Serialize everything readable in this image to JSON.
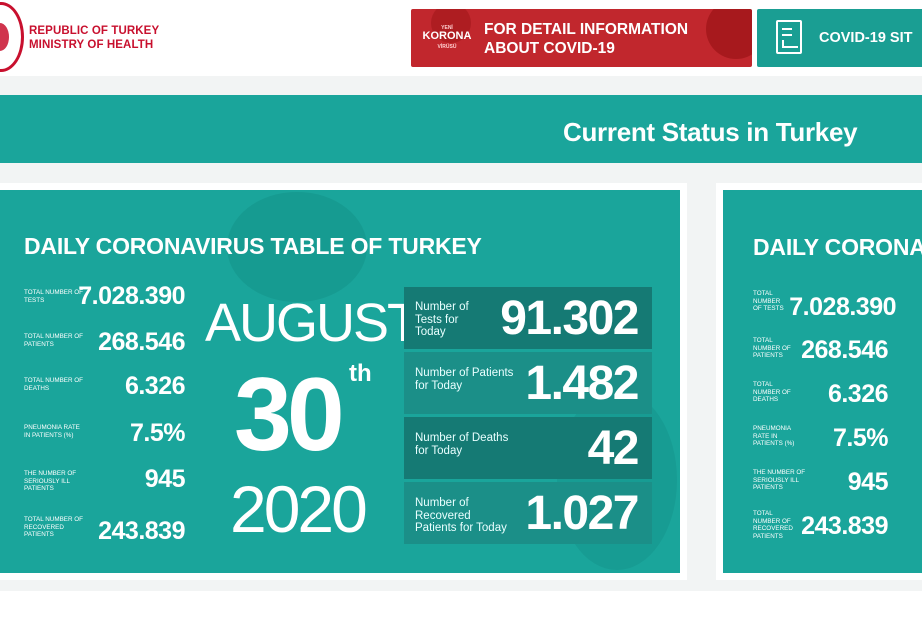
{
  "header": {
    "ministry_line1": "REPUBLIC OF TURKEY",
    "ministry_line2": "MINISTRY OF HEALTH",
    "korona_badge": {
      "top": "YENİ",
      "main": "KORONA",
      "bottom": "VİRÜSÜ"
    },
    "detail_button_line1": "FOR DETAIL INFORMATION",
    "detail_button_line2": "ABOUT COVID-19",
    "site_button_label": "COVID-19 SIT",
    "colors": {
      "brand_red": "#c8102e",
      "teal": "#1aa59b",
      "dark_teal": "#157a74"
    }
  },
  "status_title": "Current Status in Turkey",
  "card1": {
    "title": "DAILY CORONAVIRUS TABLE OF TURKEY",
    "stats": [
      {
        "label": "TOTAL NUMBER OF TESTS",
        "value": "7.028.390"
      },
      {
        "label": "TOTAL NUMBER OF PATIENTS",
        "value": "268.546"
      },
      {
        "label": "TOTAL NUMBER OF DEATHS",
        "value": "6.326"
      },
      {
        "label": "PNEUMONIA RATE IN PATIENTS (%)",
        "value": "7.5%"
      },
      {
        "label": "THE NUMBER OF SERIOUSLY ILL PATIENTS",
        "value": "945"
      },
      {
        "label": "TOTAL NUMBER OF RECOVERED PATIENTS",
        "value": "243.839"
      }
    ],
    "date": {
      "month": "AUGUST",
      "day": "30",
      "suffix": "th",
      "year": "2020"
    },
    "today": [
      {
        "label": "Number of Tests for Today",
        "value": "91.302"
      },
      {
        "label": "Number of Patients for Today",
        "value": "1.482"
      },
      {
        "label": "Number of Deaths for Today",
        "value": "42"
      },
      {
        "label": "Number of Recovered Patients for Today",
        "value": "1.027"
      }
    ]
  },
  "card2": {
    "title": "DAILY CORONA",
    "stats": [
      {
        "label": "TOTAL NUMBER OF TESTS",
        "value": "7.028.390"
      },
      {
        "label": "TOTAL NUMBER OF PATIENTS",
        "value": "268.546"
      },
      {
        "label": "TOTAL NUMBER OF DEATHS",
        "value": "6.326"
      },
      {
        "label": "PNEUMONIA RATE IN PATIENTS (%)",
        "value": "7.5%"
      },
      {
        "label": "THE NUMBER OF SERIOUSLY ILL PATIENTS",
        "value": "945"
      },
      {
        "label": "TOTAL NUMBER OF RECOVERED PATIENTS",
        "value": "243.839"
      }
    ]
  }
}
